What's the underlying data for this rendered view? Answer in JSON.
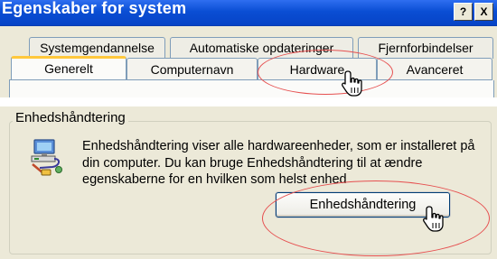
{
  "window": {
    "title": "Egenskaber for system",
    "help_button": "?",
    "close_button": "X"
  },
  "tabs": {
    "back_row": [
      "Systemgendannelse",
      "Automatiske opdateringer",
      "Fjernforbindelser"
    ],
    "front_row": [
      "Generelt",
      "Computernavn",
      "Hardware",
      "Avanceret"
    ],
    "selected": "Generelt",
    "highlighted": "Hardware"
  },
  "device_manager": {
    "group_label": "Enhedshåndtering",
    "icon": "device-manager-icon",
    "description": "Enhedshåndtering viser alle hardwareenheder, som er installeret på din computer. Du kan bruge Enhedshåndtering til at ændre egenskaberne for en hvilken som helst enhed",
    "button_label": "Enhedshåndtering"
  },
  "colors": {
    "title_bar": "#0a4ed4",
    "dialog_bg": "#ece9d8",
    "highlight_ellipse": "#e65050",
    "selected_tab_accent": "#ffc83c"
  }
}
